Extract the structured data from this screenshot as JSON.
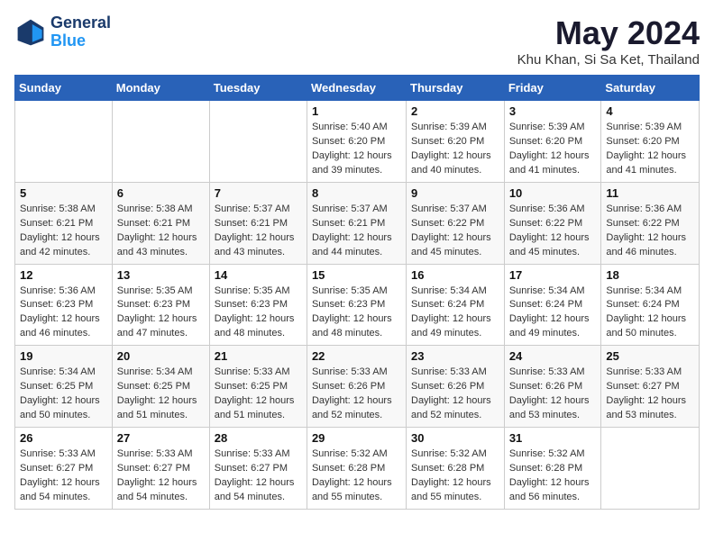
{
  "header": {
    "logo_line1": "General",
    "logo_line2": "Blue",
    "month_year": "May 2024",
    "location": "Khu Khan, Si Sa Ket, Thailand"
  },
  "weekdays": [
    "Sunday",
    "Monday",
    "Tuesday",
    "Wednesday",
    "Thursday",
    "Friday",
    "Saturday"
  ],
  "weeks": [
    [
      {
        "day": "",
        "sunrise": "",
        "sunset": "",
        "daylight": ""
      },
      {
        "day": "",
        "sunrise": "",
        "sunset": "",
        "daylight": ""
      },
      {
        "day": "",
        "sunrise": "",
        "sunset": "",
        "daylight": ""
      },
      {
        "day": "1",
        "sunrise": "Sunrise: 5:40 AM",
        "sunset": "Sunset: 6:20 PM",
        "daylight": "Daylight: 12 hours and 39 minutes."
      },
      {
        "day": "2",
        "sunrise": "Sunrise: 5:39 AM",
        "sunset": "Sunset: 6:20 PM",
        "daylight": "Daylight: 12 hours and 40 minutes."
      },
      {
        "day": "3",
        "sunrise": "Sunrise: 5:39 AM",
        "sunset": "Sunset: 6:20 PM",
        "daylight": "Daylight: 12 hours and 41 minutes."
      },
      {
        "day": "4",
        "sunrise": "Sunrise: 5:39 AM",
        "sunset": "Sunset: 6:20 PM",
        "daylight": "Daylight: 12 hours and 41 minutes."
      }
    ],
    [
      {
        "day": "5",
        "sunrise": "Sunrise: 5:38 AM",
        "sunset": "Sunset: 6:21 PM",
        "daylight": "Daylight: 12 hours and 42 minutes."
      },
      {
        "day": "6",
        "sunrise": "Sunrise: 5:38 AM",
        "sunset": "Sunset: 6:21 PM",
        "daylight": "Daylight: 12 hours and 43 minutes."
      },
      {
        "day": "7",
        "sunrise": "Sunrise: 5:37 AM",
        "sunset": "Sunset: 6:21 PM",
        "daylight": "Daylight: 12 hours and 43 minutes."
      },
      {
        "day": "8",
        "sunrise": "Sunrise: 5:37 AM",
        "sunset": "Sunset: 6:21 PM",
        "daylight": "Daylight: 12 hours and 44 minutes."
      },
      {
        "day": "9",
        "sunrise": "Sunrise: 5:37 AM",
        "sunset": "Sunset: 6:22 PM",
        "daylight": "Daylight: 12 hours and 45 minutes."
      },
      {
        "day": "10",
        "sunrise": "Sunrise: 5:36 AM",
        "sunset": "Sunset: 6:22 PM",
        "daylight": "Daylight: 12 hours and 45 minutes."
      },
      {
        "day": "11",
        "sunrise": "Sunrise: 5:36 AM",
        "sunset": "Sunset: 6:22 PM",
        "daylight": "Daylight: 12 hours and 46 minutes."
      }
    ],
    [
      {
        "day": "12",
        "sunrise": "Sunrise: 5:36 AM",
        "sunset": "Sunset: 6:23 PM",
        "daylight": "Daylight: 12 hours and 46 minutes."
      },
      {
        "day": "13",
        "sunrise": "Sunrise: 5:35 AM",
        "sunset": "Sunset: 6:23 PM",
        "daylight": "Daylight: 12 hours and 47 minutes."
      },
      {
        "day": "14",
        "sunrise": "Sunrise: 5:35 AM",
        "sunset": "Sunset: 6:23 PM",
        "daylight": "Daylight: 12 hours and 48 minutes."
      },
      {
        "day": "15",
        "sunrise": "Sunrise: 5:35 AM",
        "sunset": "Sunset: 6:23 PM",
        "daylight": "Daylight: 12 hours and 48 minutes."
      },
      {
        "day": "16",
        "sunrise": "Sunrise: 5:34 AM",
        "sunset": "Sunset: 6:24 PM",
        "daylight": "Daylight: 12 hours and 49 minutes."
      },
      {
        "day": "17",
        "sunrise": "Sunrise: 5:34 AM",
        "sunset": "Sunset: 6:24 PM",
        "daylight": "Daylight: 12 hours and 49 minutes."
      },
      {
        "day": "18",
        "sunrise": "Sunrise: 5:34 AM",
        "sunset": "Sunset: 6:24 PM",
        "daylight": "Daylight: 12 hours and 50 minutes."
      }
    ],
    [
      {
        "day": "19",
        "sunrise": "Sunrise: 5:34 AM",
        "sunset": "Sunset: 6:25 PM",
        "daylight": "Daylight: 12 hours and 50 minutes."
      },
      {
        "day": "20",
        "sunrise": "Sunrise: 5:34 AM",
        "sunset": "Sunset: 6:25 PM",
        "daylight": "Daylight: 12 hours and 51 minutes."
      },
      {
        "day": "21",
        "sunrise": "Sunrise: 5:33 AM",
        "sunset": "Sunset: 6:25 PM",
        "daylight": "Daylight: 12 hours and 51 minutes."
      },
      {
        "day": "22",
        "sunrise": "Sunrise: 5:33 AM",
        "sunset": "Sunset: 6:26 PM",
        "daylight": "Daylight: 12 hours and 52 minutes."
      },
      {
        "day": "23",
        "sunrise": "Sunrise: 5:33 AM",
        "sunset": "Sunset: 6:26 PM",
        "daylight": "Daylight: 12 hours and 52 minutes."
      },
      {
        "day": "24",
        "sunrise": "Sunrise: 5:33 AM",
        "sunset": "Sunset: 6:26 PM",
        "daylight": "Daylight: 12 hours and 53 minutes."
      },
      {
        "day": "25",
        "sunrise": "Sunrise: 5:33 AM",
        "sunset": "Sunset: 6:27 PM",
        "daylight": "Daylight: 12 hours and 53 minutes."
      }
    ],
    [
      {
        "day": "26",
        "sunrise": "Sunrise: 5:33 AM",
        "sunset": "Sunset: 6:27 PM",
        "daylight": "Daylight: 12 hours and 54 minutes."
      },
      {
        "day": "27",
        "sunrise": "Sunrise: 5:33 AM",
        "sunset": "Sunset: 6:27 PM",
        "daylight": "Daylight: 12 hours and 54 minutes."
      },
      {
        "day": "28",
        "sunrise": "Sunrise: 5:33 AM",
        "sunset": "Sunset: 6:27 PM",
        "daylight": "Daylight: 12 hours and 54 minutes."
      },
      {
        "day": "29",
        "sunrise": "Sunrise: 5:32 AM",
        "sunset": "Sunset: 6:28 PM",
        "daylight": "Daylight: 12 hours and 55 minutes."
      },
      {
        "day": "30",
        "sunrise": "Sunrise: 5:32 AM",
        "sunset": "Sunset: 6:28 PM",
        "daylight": "Daylight: 12 hours and 55 minutes."
      },
      {
        "day": "31",
        "sunrise": "Sunrise: 5:32 AM",
        "sunset": "Sunset: 6:28 PM",
        "daylight": "Daylight: 12 hours and 56 minutes."
      },
      {
        "day": "",
        "sunrise": "",
        "sunset": "",
        "daylight": ""
      }
    ]
  ]
}
